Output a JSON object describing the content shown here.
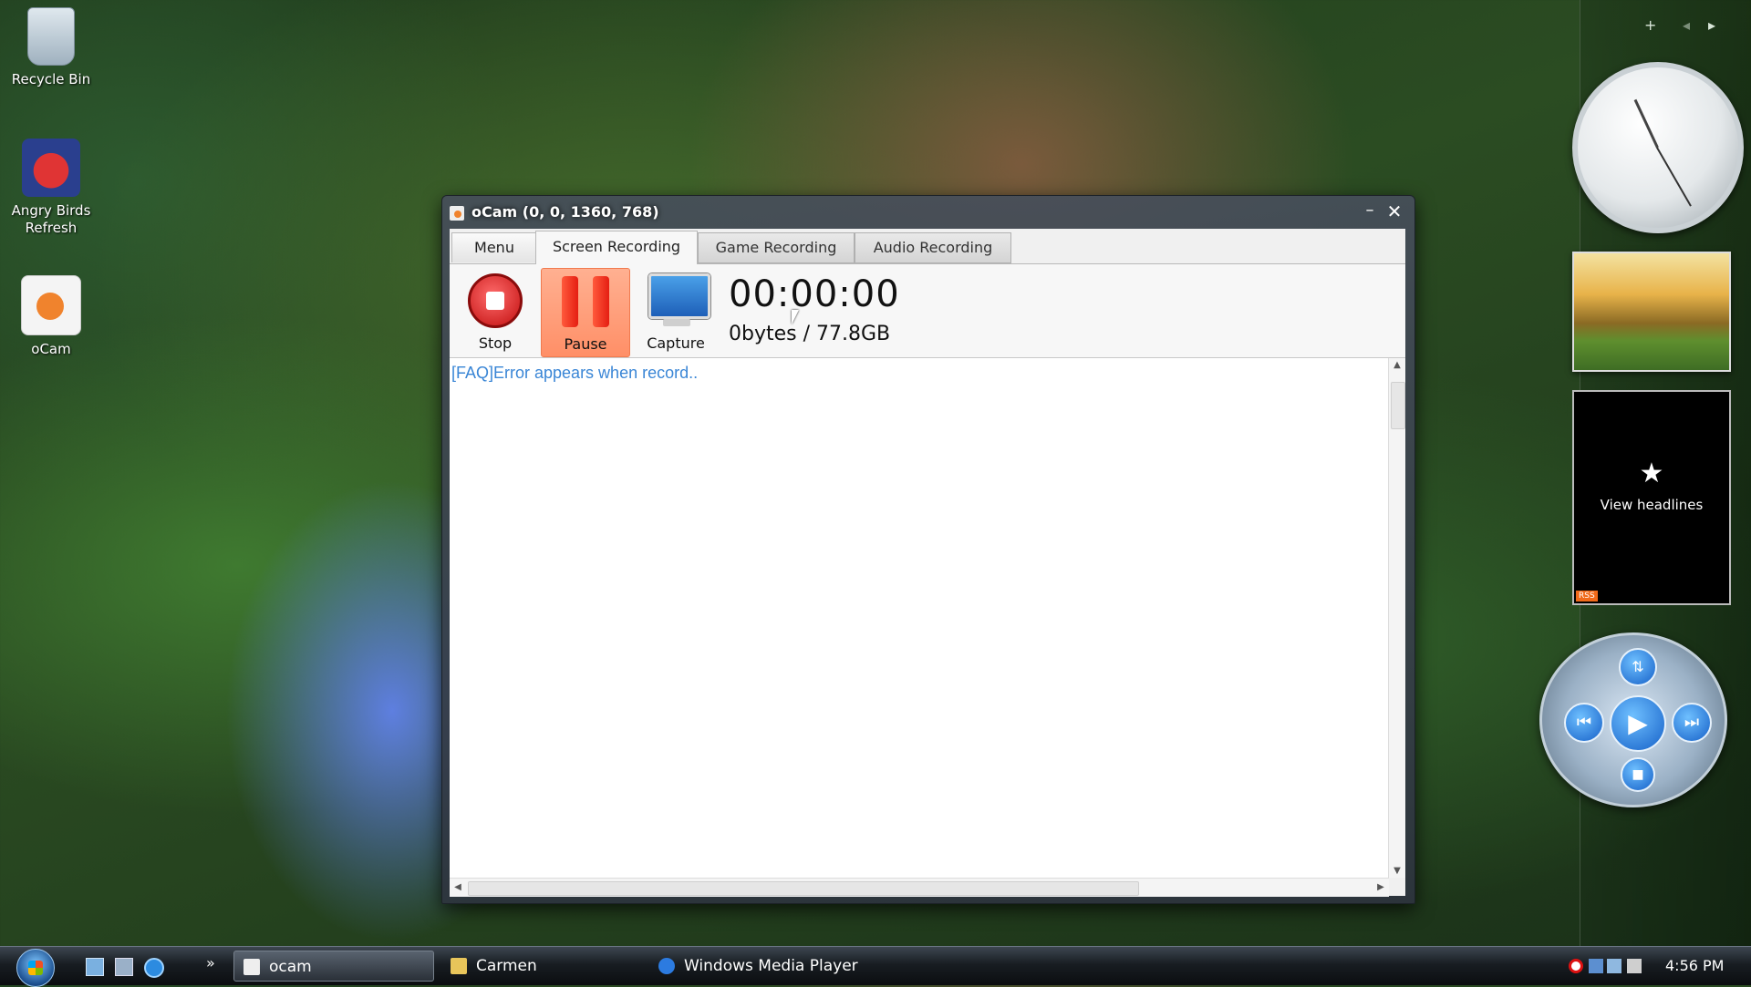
{
  "desktop": {
    "icons": [
      {
        "label": "Recycle Bin"
      },
      {
        "label": "Angry Birds Refresh"
      },
      {
        "label": "oCam"
      }
    ]
  },
  "sidebar": {
    "add_symbol": "+",
    "prev_symbol": "◂",
    "next_symbol": "▸",
    "headlines": {
      "star": "★",
      "label": "View headlines",
      "badge": "RSS"
    }
  },
  "window": {
    "title": "oCam (0, 0, 1360, 768)",
    "minimize_symbol": "–",
    "close_symbol": "✕",
    "tabs": [
      {
        "label": "Menu"
      },
      {
        "label": "Screen Recording",
        "active": true
      },
      {
        "label": "Game Recording"
      },
      {
        "label": "Audio Recording"
      }
    ],
    "toolbar": {
      "stop_label": "Stop",
      "pause_label": "Pause",
      "capture_label": "Capture",
      "timer": "00:00:00",
      "size": "0bytes / 77.8GB"
    },
    "log": {
      "faq_link": "[FAQ]Error appears when record.."
    }
  },
  "taskbar": {
    "more_symbol": "»",
    "tasks": [
      {
        "label": "ocam",
        "active": true
      },
      {
        "label": "Carmen"
      },
      {
        "label": "Windows Media Player"
      }
    ],
    "clock": "4:56 PM"
  },
  "colors": {
    "link": "#3a86d6",
    "pause_highlight": "#ff8f67",
    "stop_red": "#c10e0e"
  }
}
